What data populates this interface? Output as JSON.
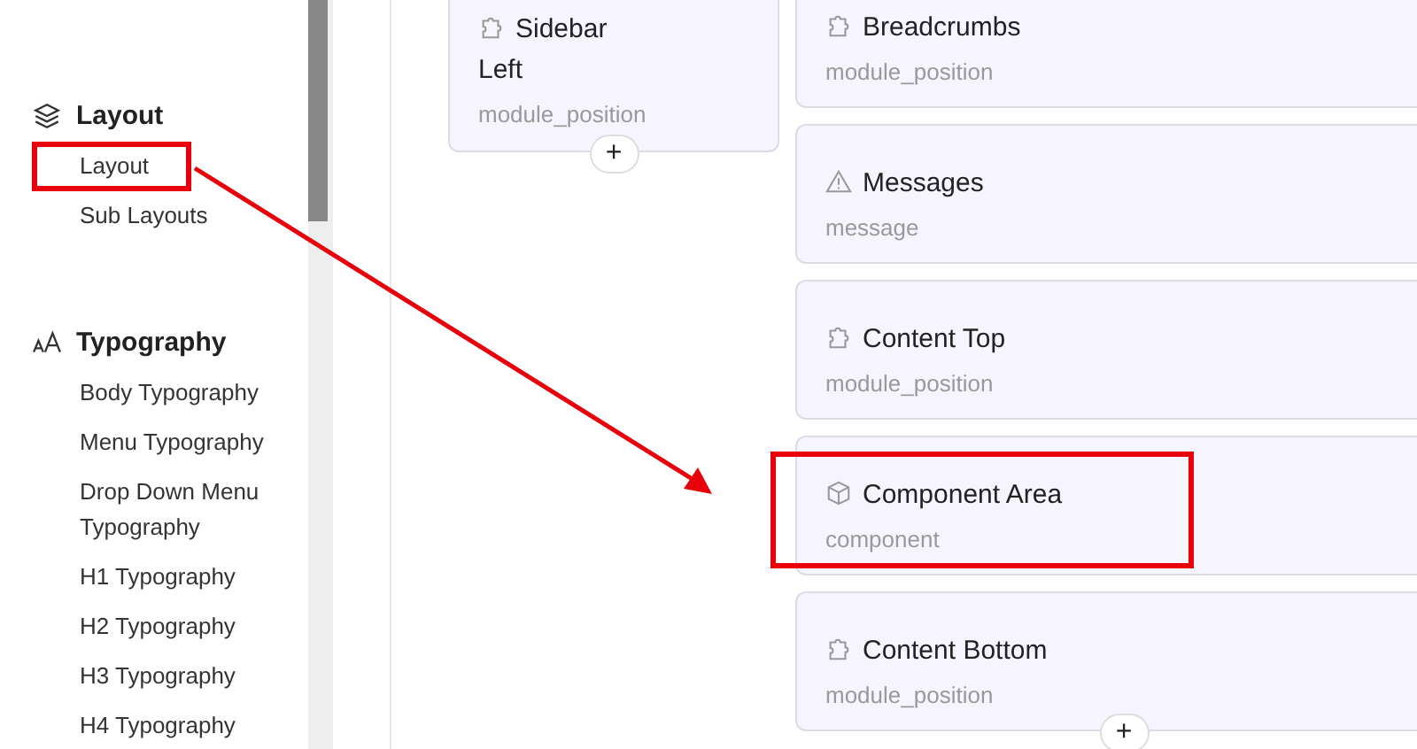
{
  "sidebar": {
    "groups": [
      {
        "title": "Layout",
        "items": [
          {
            "label": "Layout",
            "highlighted": true
          },
          {
            "label": "Sub Layouts",
            "highlighted": false
          }
        ]
      },
      {
        "title": "Typography",
        "items": [
          {
            "label": "Body Typography",
            "highlighted": false
          },
          {
            "label": "Menu Typography",
            "highlighted": false
          },
          {
            "label": "Drop Down Menu Typography",
            "highlighted": false
          },
          {
            "label": "H1 Typography",
            "highlighted": false
          },
          {
            "label": "H2 Typography",
            "highlighted": false
          },
          {
            "label": "H3 Typography",
            "highlighted": false
          },
          {
            "label": "H4 Typography",
            "highlighted": false
          }
        ]
      }
    ]
  },
  "left_column": [
    {
      "kind": "module",
      "title": "Sidebar Left",
      "type": "module_position",
      "highlighted": false,
      "add_button": "+"
    }
  ],
  "right_column": [
    {
      "kind": "module",
      "title": "Breadcrumbs",
      "type": "module_position",
      "highlighted": false
    },
    {
      "kind": "message",
      "title": "Messages",
      "type": "message",
      "highlighted": false
    },
    {
      "kind": "module",
      "title": "Content Top",
      "type": "module_position",
      "highlighted": false
    },
    {
      "kind": "component",
      "title": "Component Area",
      "type": "component",
      "highlighted": true
    },
    {
      "kind": "module",
      "title": "Content Bottom",
      "type": "module_position",
      "highlighted": false,
      "add_button": "+"
    }
  ]
}
